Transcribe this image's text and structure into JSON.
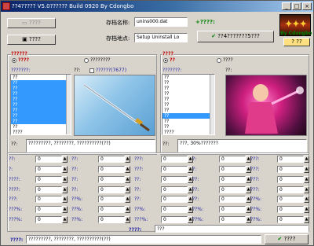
{
  "window": {
    "title": "??4????? V5.0?????? Build 0920 By Cdongbo"
  },
  "top": {
    "open_button": "????",
    "save_button": "????",
    "archive_name_label": "存档名称:",
    "archive_name_value": "unins000.dat",
    "archive_path_label": "存档地点:",
    "archive_path_value": "Setup Uninstall Lo",
    "plus_label": "+????:",
    "apply_button": "??4???????5???",
    "logo_sub": "By Cdongbo",
    "help_button": "??"
  },
  "left_panel": {
    "group_title": "??????",
    "radio1": "????",
    "radio2": "????????",
    "list_label": "???????:",
    "icon_label": "??:",
    "checkbox_label": "??????(7677)",
    "items": [
      "??",
      "??",
      "??",
      "??",
      "??",
      "??",
      "??",
      "??",
      "??",
      "??",
      "????",
      "????",
      "??"
    ],
    "desc_label": "??:",
    "desc_value": "?????????, ????????, ??????????(??)"
  },
  "right_panel": {
    "group_title": "????",
    "radio1": "??",
    "radio2": "????",
    "list_label": "???????:",
    "icon_label": "??:",
    "items": [
      "??",
      "??",
      "??",
      "??",
      "??",
      "??",
      "??",
      "??",
      "??",
      "??",
      "????",
      "??",
      "??"
    ],
    "desc_label": "??:",
    "desc_value": "???, 30%???????"
  },
  "stats": {
    "rows": [
      [
        {
          "l": "??:",
          "v": "0"
        },
        {
          "l": "??:",
          "v": "0"
        },
        {
          "l": "???:",
          "v": "0"
        },
        {
          "l": "?:",
          "v": "0"
        },
        {
          "l": "???:",
          "v": "0"
        }
      ],
      [
        {
          "l": "?:",
          "v": "0"
        },
        {
          "l": "??:",
          "v": "0"
        },
        {
          "l": "???:",
          "v": "0"
        },
        {
          "l": "?:",
          "v": "0"
        },
        {
          "l": "???:",
          "v": "0"
        }
      ],
      [
        {
          "l": "????:",
          "v": "0"
        },
        {
          "l": "??:",
          "v": "0"
        },
        {
          "l": "??:",
          "v": "0"
        },
        {
          "l": "??:",
          "v": "0"
        },
        {
          "l": "???:",
          "v": "0"
        }
      ],
      [
        {
          "l": "????:",
          "v": "0"
        },
        {
          "l": "??:",
          "v": "0"
        },
        {
          "l": "??:",
          "v": "0"
        },
        {
          "l": "??:",
          "v": "0"
        },
        {
          "l": "???:",
          "v": "0"
        }
      ],
      [
        {
          "l": "???:",
          "v": "0"
        },
        {
          "l": "??%:",
          "v": "0"
        },
        {
          "l": "??:",
          "v": "0"
        },
        {
          "l": "??:",
          "v": "0"
        },
        {
          "l": "??%:",
          "v": "0"
        }
      ],
      [
        {
          "l": "???%:",
          "v": "0"
        },
        {
          "l": "??%:",
          "v": "0"
        },
        {
          "l": "??%:",
          "v": "0"
        },
        {
          "l": "??%:",
          "v": "0"
        },
        {
          "l": "??%:",
          "v": "0"
        }
      ],
      [
        {
          "l": "???%:",
          "v": "0"
        },
        {
          "l": "??%:",
          "v": "0"
        },
        {
          "l": "???%:",
          "v": "0"
        },
        {
          "l": "??%:",
          "v": "0"
        },
        {
          "l": "??%:",
          "v": "0"
        }
      ]
    ],
    "skill_label": "????:",
    "skill_value": "???",
    "bottom_label": "????:",
    "bottom_value": "?????????, ????????, ??????????(??)",
    "confirm_button": "????"
  },
  "colors": {
    "title_bar": "#0a246a",
    "accent_green": "#008000",
    "select": "#3399ff"
  }
}
